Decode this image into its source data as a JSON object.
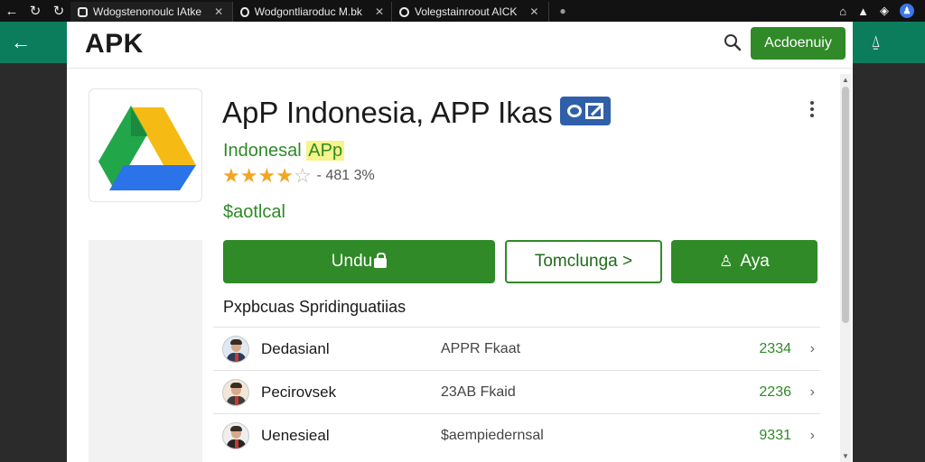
{
  "browser": {
    "nav": {
      "back": "←",
      "forward": "↻",
      "reload": "↻"
    },
    "tabs": [
      {
        "title": "Wdogstenonoulc IAtke"
      },
      {
        "title": "Wodgontliaroduc M.bk"
      },
      {
        "title": "Volegstainroout AICK"
      }
    ]
  },
  "header": {
    "logo": "APK",
    "action_button": "Acdoenuiy"
  },
  "app": {
    "title": "ApP Indonesia, APP Ikas",
    "developer_prefix": "Indonesal ",
    "developer_highlight": "APp",
    "rating_text": "- 481 3%",
    "rating_stars": 4,
    "price": "$aotlcal"
  },
  "buttons": {
    "primary": "Undu",
    "outline": "Tomclunga >",
    "third": "Aya"
  },
  "section_title": "Pxpbcuas Spridinguatiias",
  "list": [
    {
      "name": "Dedasianl",
      "desc": "APPR Fkaat",
      "num": "2334"
    },
    {
      "name": "Pecirovsek",
      "desc": "23AB Fkaid",
      "num": "2236"
    },
    {
      "name": "Uenesieal",
      "desc": "$aempiedernsal",
      "num": "9331"
    }
  ],
  "colors": {
    "accent_green": "#2f8a27",
    "top_green": "#0b7d5c",
    "title_badge": "#2f5fa8"
  }
}
